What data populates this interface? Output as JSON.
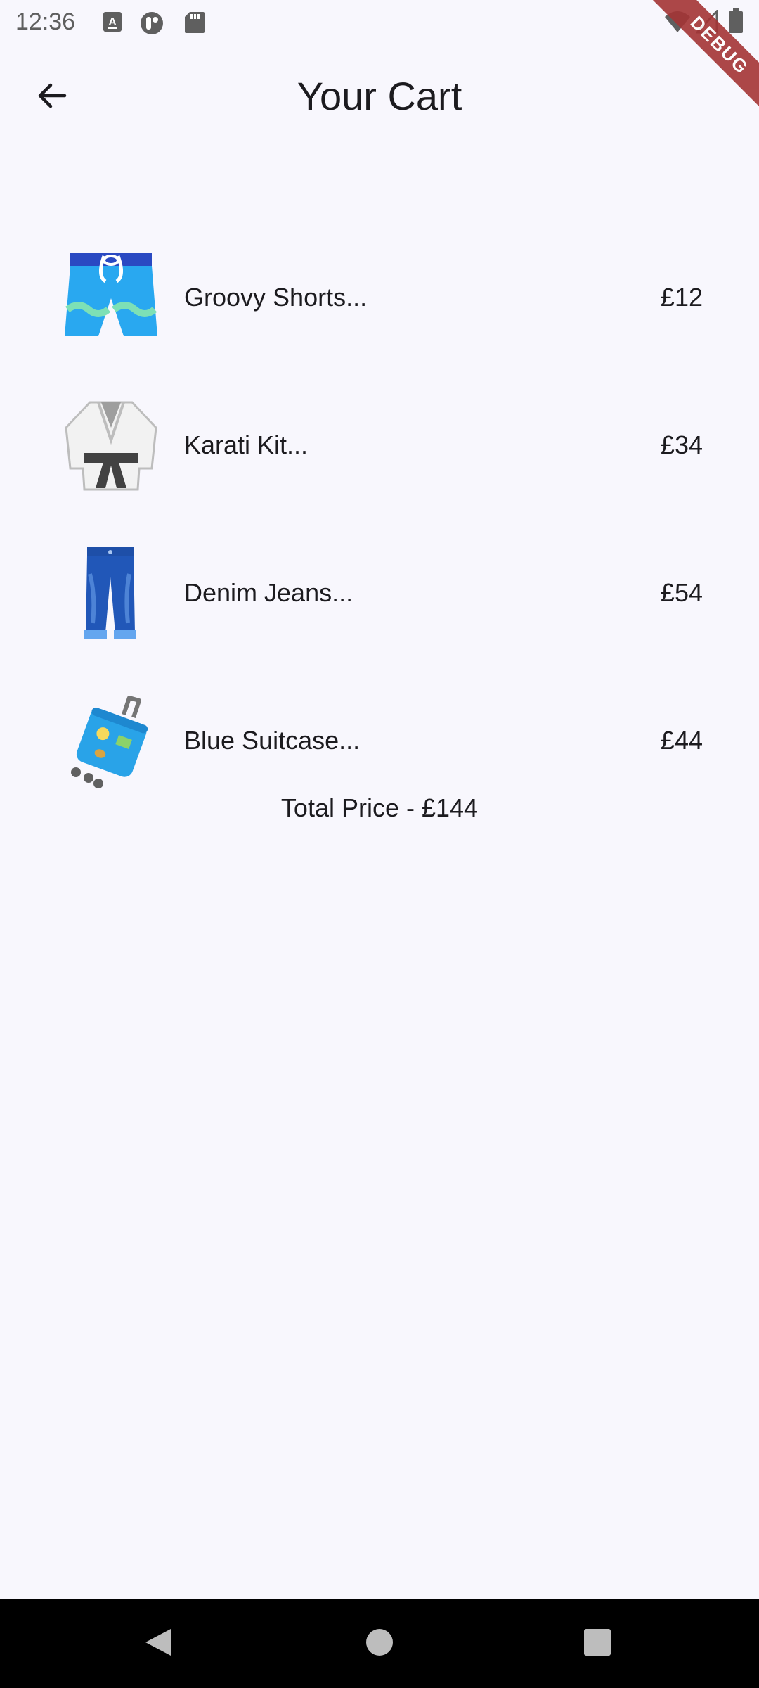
{
  "status_bar": {
    "time": "12:36",
    "icons": [
      "keyboard-a-icon",
      "assistant-icon",
      "sd-card-icon",
      "wifi-icon",
      "signal-icon",
      "battery-icon"
    ]
  },
  "debug_banner": {
    "label": "DEBUG",
    "color": "#a43435"
  },
  "app_bar": {
    "title": "Your Cart",
    "back_icon": "arrow-left-icon"
  },
  "cart": {
    "items": [
      {
        "name": "Groovy Shorts...",
        "price": "£12",
        "icon": "shorts-icon"
      },
      {
        "name": "Karati Kit...",
        "price": "£34",
        "icon": "martial-arts-uniform-icon"
      },
      {
        "name": "Denim Jeans...",
        "price": "£54",
        "icon": "jeans-icon"
      },
      {
        "name": "Blue Suitcase...",
        "price": "£44",
        "icon": "suitcase-icon"
      }
    ],
    "total_label": "Total Price - £144"
  },
  "nav_bar": {
    "buttons": [
      "back-triangle-icon",
      "home-circle-icon",
      "recents-square-icon"
    ]
  },
  "colors": {
    "background": "#f8f7fd",
    "text": "#1c1b1f",
    "nav_bar": "#000000"
  }
}
